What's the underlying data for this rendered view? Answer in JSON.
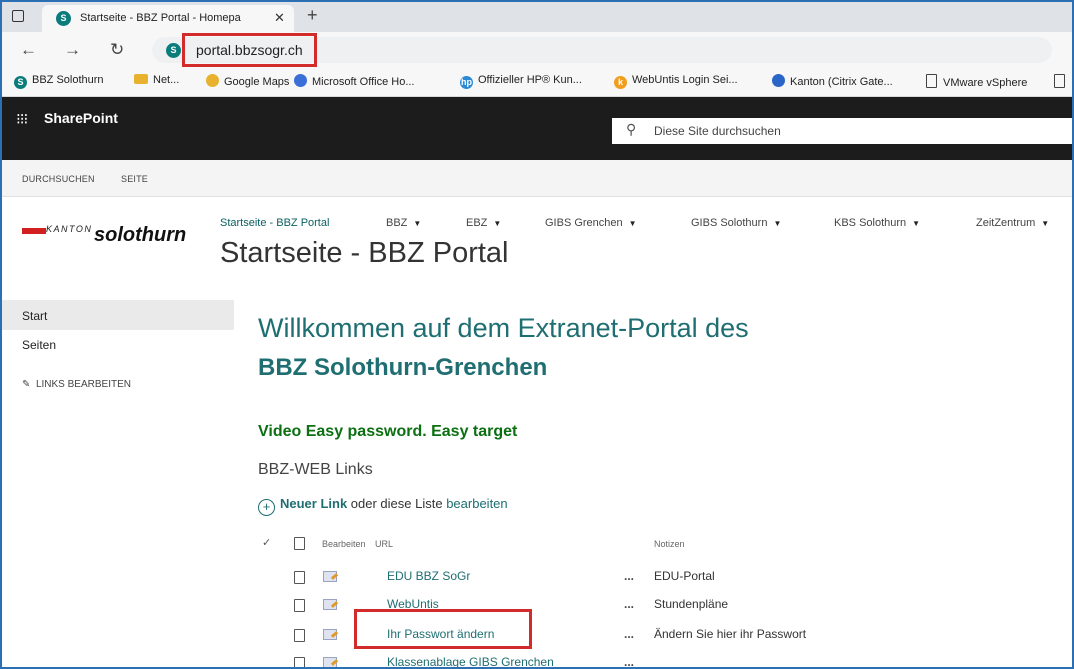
{
  "browser": {
    "tab_title": "Startseite - BBZ Portal - Homepa",
    "tab_close": "✕",
    "new_tab": "+",
    "url": "portal.bbzsogr.ch",
    "bookmarks": [
      {
        "label": "BBZ Solothurn",
        "icon": "sharepoint-icon",
        "color": "#0a7c7c"
      },
      {
        "label": "Net...",
        "icon": "folder-icon",
        "color": "#e8b22e"
      },
      {
        "label": "Google Maps",
        "icon": "maps-pin-icon",
        "color": "#e8b22e"
      },
      {
        "label": "Microsoft Office Ho...",
        "icon": "office-icon",
        "color": "#3a6fd8"
      },
      {
        "label": "Offizieller HP® Kun...",
        "icon": "hp-icon",
        "color": "#2b8ad6"
      },
      {
        "label": "WebUntis Login Sei...",
        "icon": "webuntis-icon",
        "color": "#f29d1e"
      },
      {
        "label": "Kanton (Citrix Gate...",
        "icon": "citrix-icon",
        "color": "#2a66c7"
      },
      {
        "label": "VMware vSphere",
        "icon": "document-icon",
        "color": "#444444"
      }
    ]
  },
  "sharepoint": {
    "brand": "SharePoint",
    "search_placeholder": "Diese Site durchsuchen"
  },
  "ribbon": {
    "browse": "DURCHSUCHEN",
    "page": "SEITE"
  },
  "header": {
    "logo_kanton": "KANTON",
    "logo_solothurn": "solothurn",
    "site_title": "Startseite - BBZ Portal",
    "topnav": [
      {
        "label": "Startseite - BBZ Portal",
        "caret": ""
      },
      {
        "label": "BBZ",
        "caret": "▼"
      },
      {
        "label": "EBZ",
        "caret": "▼"
      },
      {
        "label": "GIBS Grenchen",
        "caret": "▼"
      },
      {
        "label": "GIBS Solothurn",
        "caret": "▼"
      },
      {
        "label": "KBS Solothurn",
        "caret": "▼"
      },
      {
        "label": "ZeitZentrum",
        "caret": "▼"
      }
    ]
  },
  "leftnav": {
    "start": "Start",
    "pages": "Seiten",
    "edit_links": "LINKS BEARBEITEN"
  },
  "content": {
    "welcome_line1": "Willkommen auf dem Extranet-Portal des",
    "welcome_line2": "BBZ Solothurn-Grenchen",
    "video_link": "Video Easy password. Easy target",
    "links_title": "BBZ-WEB Links",
    "new_link": "Neuer Link",
    "or_edit_text": " oder diese Liste ",
    "edit_link": "bearbeiten",
    "columns": {
      "edit": "Bearbeiten",
      "url": "URL",
      "notes": "Notizen"
    },
    "rows": [
      {
        "url": "EDU BBZ SoGr",
        "dots": "...",
        "note": "EDU-Portal"
      },
      {
        "url": "WebUntis",
        "dots": "...",
        "note": "Stundenpläne"
      },
      {
        "url": "Ihr Passwort ändern",
        "dots": "...",
        "note": "Ändern Sie hier ihr Passwort"
      },
      {
        "url": "Klassenablage GIBS Grenchen",
        "dots": "...",
        "note": ""
      }
    ]
  },
  "colors": {
    "accent": "#1f6e71",
    "highlight": "#d12b2b",
    "video": "#0c6f12",
    "suitebar": "#1c1c1c"
  }
}
